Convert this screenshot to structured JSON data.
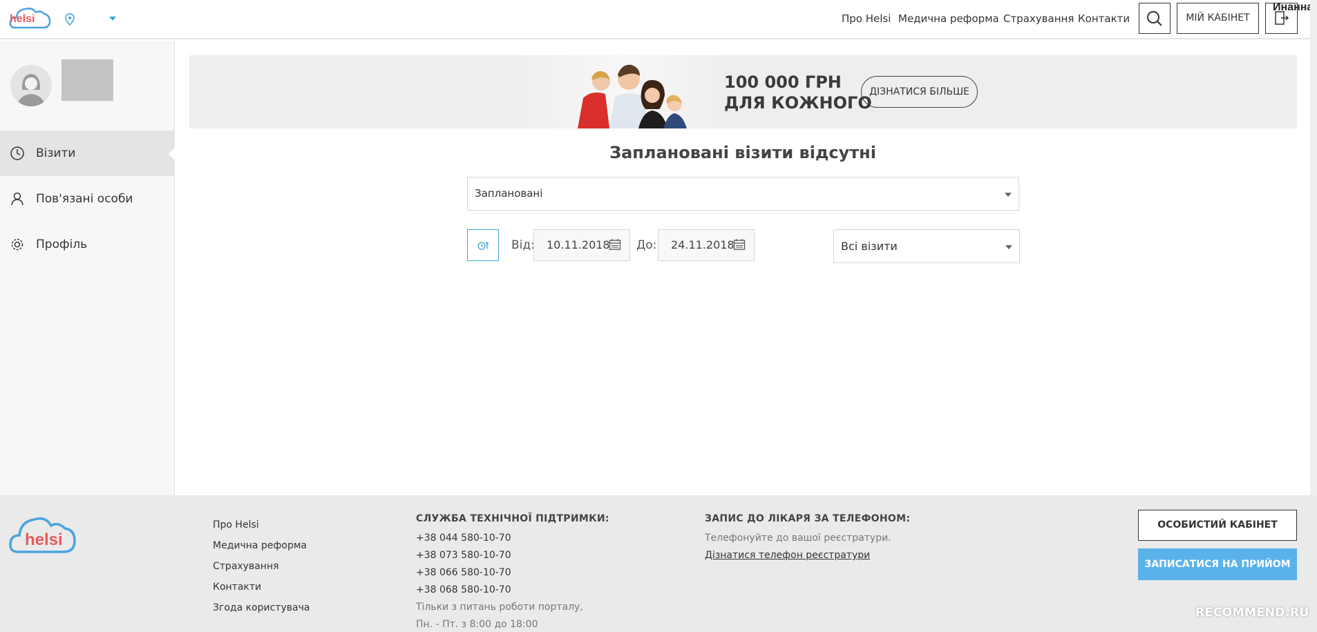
{
  "header": {
    "logo": "helsi",
    "nav": [
      "Про Helsi",
      "Медична реформа",
      "Страхування",
      "Контакти"
    ],
    "cabinet_label": "МІЙ КАБІНЕТ",
    "username": "Инанна"
  },
  "sidebar": {
    "items": [
      {
        "label": "Візити",
        "icon": "clock-icon"
      },
      {
        "label": "Пов'язані особи",
        "icon": "user-icon"
      },
      {
        "label": "Профіль",
        "icon": "gear-icon"
      }
    ]
  },
  "banner": {
    "line1": "100 000 ГРН",
    "line2": "ДЛЯ КОЖНОГО",
    "button": "ДІЗНАТИСЯ БІЛЬШЕ"
  },
  "main": {
    "title": "Заплановані візити відсутні",
    "filter_select": "Заплановані",
    "from_label": "Від:",
    "from_date": "10.11.2018",
    "to_label": "До:",
    "to_date": "24.11.2018",
    "visits_select": "Всі візити"
  },
  "footer": {
    "links": [
      "Про Helsi",
      "Медична реформа",
      "Страхування",
      "Контакти",
      "Згода користувача"
    ],
    "support_title": "СЛУЖБА ТЕХНІЧНОЇ ПІДТРИМКИ:",
    "phones": [
      "+38 044 580-10-70",
      "+38 073 580-10-70",
      "+38 066 580-10-70",
      "+38 068 580-10-70"
    ],
    "support_note1": "Тільки з питань роботи порталу,",
    "support_note2": "Пн. - Пт. з 8:00 до 18:00",
    "record_title": "ЗАПИС ДО ЛІКАРЯ ЗА ТЕЛЕФОНОМ:",
    "record_note": "Телефонуйте до вашої реєстратури.",
    "record_link": "Дізнатися телефон реєстратури",
    "btn_cabinet": "ОСОБИСТИЙ КАБІНЕТ",
    "btn_appointment": "ЗАПИСАТИСЯ НА ПРИЙОМ",
    "watermark": "RECOMMEND.RU"
  },
  "colors": {
    "accent": "#3aa5db",
    "button_blue": "#5ab2ea",
    "logo_red": "#e85a5a"
  }
}
